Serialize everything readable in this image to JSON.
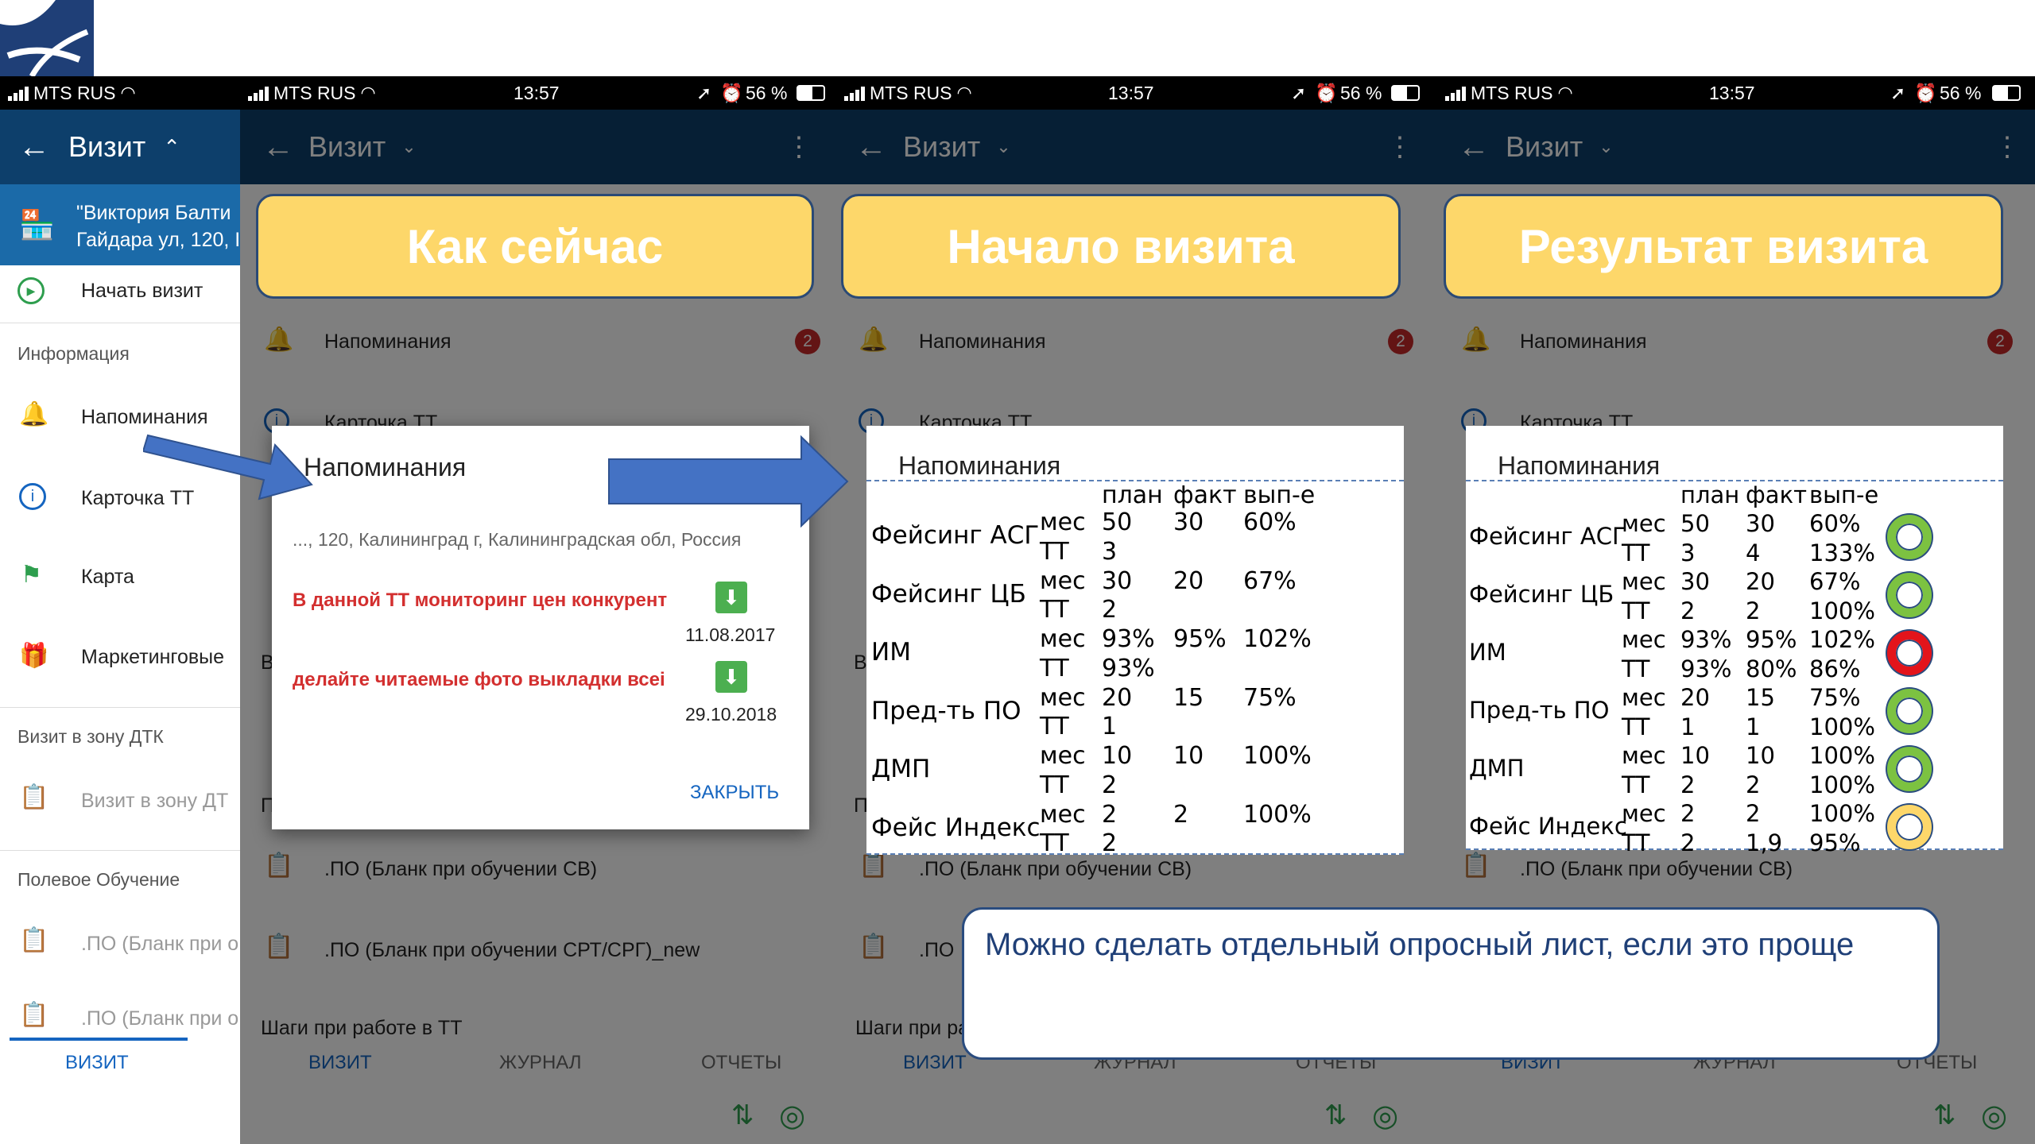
{
  "status": {
    "carrier": "MTS RUS",
    "time": "13:57",
    "battery": "56 %"
  },
  "app": {
    "title": "Визит"
  },
  "store": {
    "line1": "\"Виктория Балти",
    "line2": "Гайдара ул, 120, I"
  },
  "menu": {
    "start": "Начать визит",
    "section_info": "Информация",
    "reminders": "Напоминания",
    "card": "Карточка ТТ",
    "map": "Карта",
    "marketing": "Маркетинговые",
    "section_dtk": "Визит в зону ДТК",
    "dtk_item": "Визит в зону ДТ",
    "section_training": "Полевое Обучение",
    "training1": ".ПО (Бланк при о",
    "training2": ".ПО (Бланк при о",
    "tab": "ВИЗИТ"
  },
  "bg": {
    "reminders": "Напоминания",
    "badge": "2",
    "card": "Карточка ТТ",
    "b_letter": "В",
    "p_letter": "П",
    "po_sv": ".ПО (Бланк при обучении СВ)",
    "po_srt": ".ПО (Бланк при обучении СРТ/СРГ)_new",
    "po_short": ".ПО",
    "steps": "Шаги при работе в ТТ",
    "steps_short": "Шаги при ра",
    "tabs": [
      "ВИЗИТ",
      "ЖУРНАЛ",
      "ОТЧЕТЫ"
    ]
  },
  "banners": [
    "Как сейчас",
    "Начало визита",
    "Результат визита"
  ],
  "dialog": {
    "title": "Напоминания",
    "address": "..., 120, Калининград г, Калининградская обл, Россия",
    "item1": "В данной ТТ мониторинг цен конкурент",
    "date1": "11.08.2017",
    "item2": "делайте читаемые фото выкладки всеі",
    "date2": "29.10.2018",
    "close": "ЗАКРЫТЬ"
  },
  "table2": {
    "title": "Напоминания",
    "headers": [
      "план",
      "факт",
      "вып-е"
    ],
    "rows": [
      {
        "name": "Фейсинг АСГ",
        "mes": [
          "мес",
          "50",
          "30",
          "60%"
        ],
        "tt": [
          "ТТ",
          "3",
          "",
          ""
        ]
      },
      {
        "name": "Фейсинг ЦБ",
        "mes": [
          "мес",
          "30",
          "20",
          "67%"
        ],
        "tt": [
          "ТТ",
          "2",
          "",
          ""
        ]
      },
      {
        "name": "ИМ",
        "mes": [
          "мес",
          "93%",
          "95%",
          "102%"
        ],
        "tt": [
          "ТТ",
          "93%",
          "",
          ""
        ]
      },
      {
        "name": "Пред-ть ПО",
        "mes": [
          "мес",
          "20",
          "15",
          "75%"
        ],
        "tt": [
          "ТТ",
          "1",
          "",
          ""
        ]
      },
      {
        "name": "ДМП",
        "mes": [
          "мес",
          "10",
          "10",
          "100%"
        ],
        "tt": [
          "ТТ",
          "2",
          "",
          ""
        ]
      },
      {
        "name": "Фейс Индекс",
        "mes": [
          "мес",
          "2",
          "2",
          "100%"
        ],
        "tt": [
          "ТТ",
          "2",
          "",
          ""
        ]
      }
    ]
  },
  "table3": {
    "title": "Напоминания",
    "headers": [
      "план",
      "факт",
      "вып-е"
    ],
    "rows": [
      {
        "name": "Фейсинг АСГ",
        "mes": [
          "мес",
          "50",
          "30",
          "60%"
        ],
        "tt": [
          "ТТ",
          "3",
          "4",
          "133%"
        ],
        "status": "#7cc241"
      },
      {
        "name": "Фейсинг ЦБ",
        "mes": [
          "мес",
          "30",
          "20",
          "67%"
        ],
        "tt": [
          "ТТ",
          "2",
          "2",
          "100%"
        ],
        "status": "#7cc241"
      },
      {
        "name": "ИМ",
        "mes": [
          "мес",
          "93%",
          "95%",
          "102%"
        ],
        "tt": [
          "ТТ",
          "93%",
          "80%",
          "86%"
        ],
        "status": "#e3141b"
      },
      {
        "name": "Пред-ть ПО",
        "mes": [
          "мес",
          "20",
          "15",
          "75%"
        ],
        "tt": [
          "ТТ",
          "1",
          "1",
          "100%"
        ],
        "status": "#7cc241"
      },
      {
        "name": "ДМП",
        "mes": [
          "мес",
          "10",
          "10",
          "100%"
        ],
        "tt": [
          "ТТ",
          "2",
          "2",
          "100%"
        ],
        "status": "#7cc241"
      },
      {
        "name": "Фейс Индекс",
        "mes": [
          "мес",
          "2",
          "2",
          "100%"
        ],
        "tt": [
          "ТТ",
          "2",
          "1,9",
          "95%"
        ],
        "status": "#fdd76a"
      }
    ]
  },
  "note": {
    "text": "Можно сделать отдельный опросный лист, если это проще"
  },
  "colors": {
    "appbar": "#0d3f6b",
    "banner": "#fdd76a",
    "arrow": "#4472c4",
    "alert": "#d32f2f",
    "link": "#1565c0"
  }
}
